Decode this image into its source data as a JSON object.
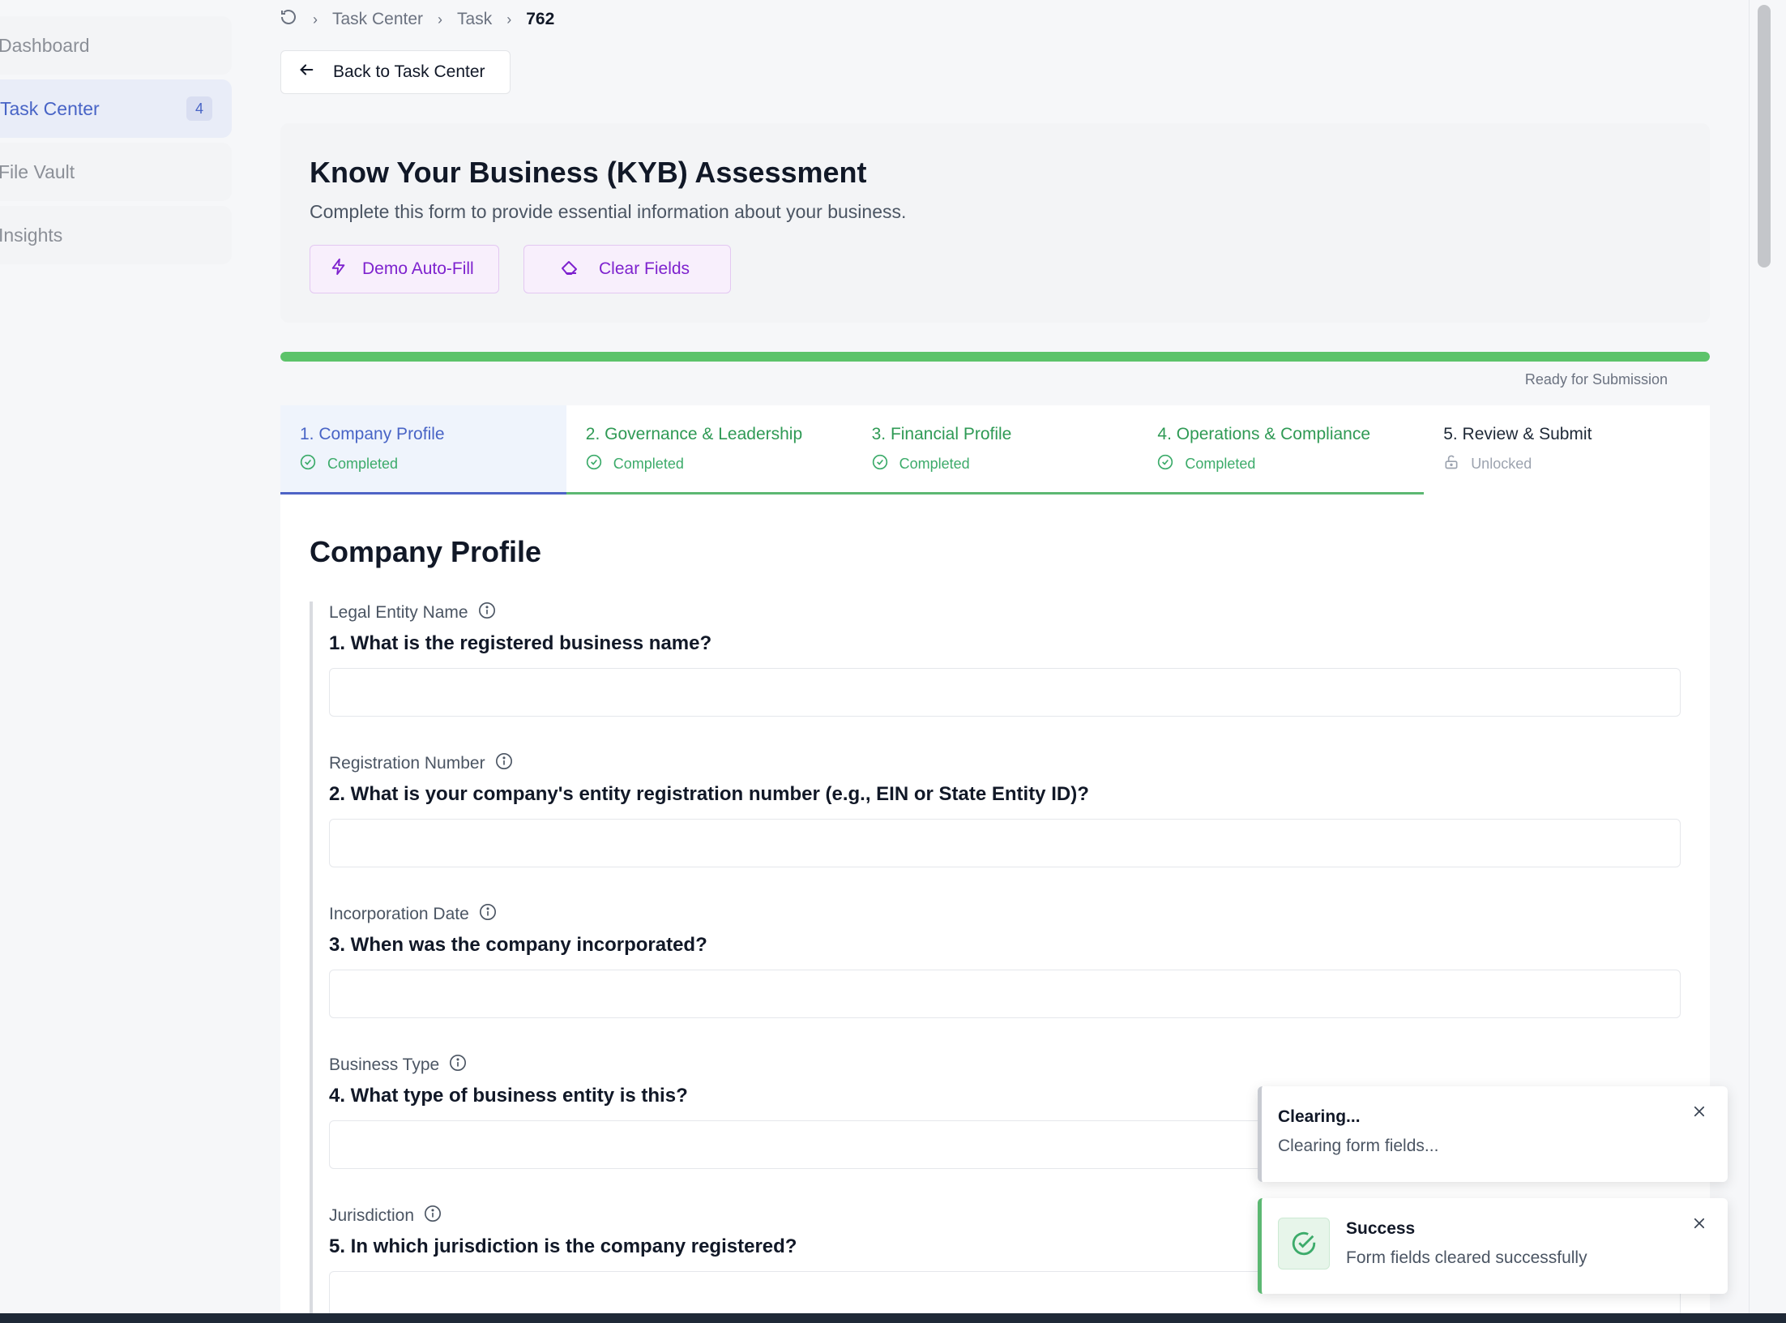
{
  "sidebar": {
    "items": [
      {
        "label": "Dashboard"
      },
      {
        "label": "Task Center",
        "badge": "4"
      },
      {
        "label": "File Vault"
      },
      {
        "label": "Insights"
      }
    ]
  },
  "breadcrumb": {
    "items": [
      "Task Center",
      "Task"
    ],
    "current": "762"
  },
  "back_button": {
    "label": "Back to Task Center"
  },
  "header": {
    "title": "Know Your Business (KYB) Assessment",
    "subtitle": "Complete this form to provide essential information about your business.",
    "demo_autofill_label": "Demo Auto-Fill",
    "clear_fields_label": "Clear Fields"
  },
  "progress": {
    "percent": 100,
    "label": "Ready for Submission",
    "color": "#5cc36a"
  },
  "tabs": [
    {
      "label": "1. Company Profile",
      "status": "Completed",
      "state": "active"
    },
    {
      "label": "2. Governance & Leadership",
      "status": "Completed",
      "state": "done"
    },
    {
      "label": "3. Financial Profile",
      "status": "Completed",
      "state": "done"
    },
    {
      "label": "4. Operations & Compliance",
      "status": "Completed",
      "state": "done"
    },
    {
      "label": "5. Review & Submit",
      "status": "Unlocked",
      "state": "unlocked"
    }
  ],
  "form": {
    "section_title": "Company Profile",
    "questions": [
      {
        "label": "Legal Entity Name",
        "question": "1. What is the registered business name?",
        "value": ""
      },
      {
        "label": "Registration Number",
        "question": "2. What is your company's entity registration number (e.g., EIN or State Entity ID)?",
        "value": ""
      },
      {
        "label": "Incorporation Date",
        "question": "3. When was the company incorporated?",
        "value": ""
      },
      {
        "label": "Business Type",
        "question": "4. What type of business entity is this?",
        "value": ""
      },
      {
        "label": "Jurisdiction",
        "question": "5. In which jurisdiction is the company registered?",
        "value": ""
      }
    ]
  },
  "toasts": {
    "clearing": {
      "title": "Clearing...",
      "message": "Clearing form fields..."
    },
    "success": {
      "title": "Success",
      "message": "Form fields cleared successfully"
    }
  },
  "colors": {
    "accent": "#4864c6",
    "purple": "#7e22ce",
    "success": "#5cb872"
  }
}
